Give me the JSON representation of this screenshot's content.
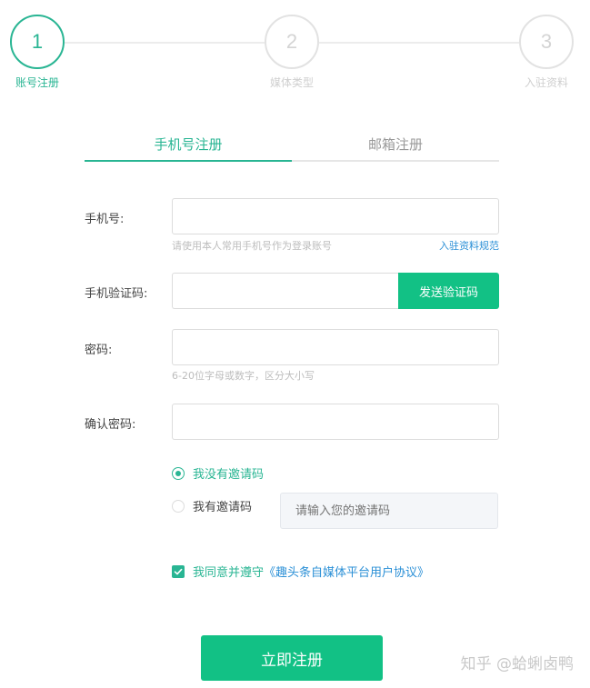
{
  "steps": [
    {
      "number": "1",
      "label": "账号注册",
      "active": true
    },
    {
      "number": "2",
      "label": "媒体类型",
      "active": false
    },
    {
      "number": "3",
      "label": "入驻资料",
      "active": false
    }
  ],
  "tabs": [
    {
      "label": "手机号注册",
      "active": true
    },
    {
      "label": "邮箱注册",
      "active": false
    }
  ],
  "form": {
    "phone_label": "手机号:",
    "phone_value": "",
    "phone_hint": "请使用本人常用手机号作为登录账号",
    "rules_link": "入驻资料规范",
    "code_label": "手机验证码:",
    "code_value": "",
    "send_code_button": "发送验证码",
    "password_label": "密码:",
    "password_value": "",
    "password_hint": "6-20位字母或数字，区分大小写",
    "confirm_label": "确认密码:",
    "confirm_value": ""
  },
  "invite": {
    "no_code_label": "我没有邀请码",
    "has_code_label": "我有邀请码",
    "selected": "no_code",
    "code_placeholder": "请输入您的邀请码"
  },
  "agreement": {
    "checked": true,
    "text": "我同意并遵守",
    "protocol_link": "《趣头条自媒体平台用户协议》"
  },
  "submit_button": "立即注册",
  "watermark": "知乎 @蛤蜊卤鸭",
  "colors": {
    "accent": "#29b593",
    "button": "#12c185",
    "link": "#2a8fd6"
  }
}
